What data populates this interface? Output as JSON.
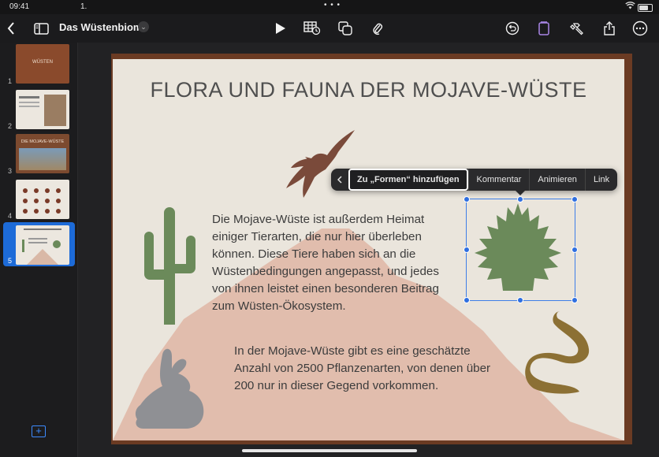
{
  "status": {
    "time": "09:41",
    "carrier": "1."
  },
  "toolbar": {
    "document_title": "Das Wüstenbiom",
    "colors": {
      "accent_icon": "#a986e6"
    }
  },
  "navigator": {
    "slides": [
      {
        "number": "1",
        "title": "WÜSTEN"
      },
      {
        "number": "2",
        "title": ""
      },
      {
        "number": "3",
        "title": "DIE MOJAVE-WÜSTE"
      },
      {
        "number": "4",
        "title": ""
      },
      {
        "number": "5",
        "title": "",
        "selected": true
      }
    ]
  },
  "slide": {
    "title": "FLORA UND FAUNA DER MOJAVE-WÜSTE",
    "paragraph_1": "Die Mojave-Wüste ist außerdem Heimat einiger Tierarten, die nur hier überleben können. Diese Tiere haben sich an die Wüstenbedingungen angepasst, und jedes von ihnen leistet einen besonderen Beitrag zum Wüsten-Ökosystem.",
    "paragraph_2": "In der Mojave-Wüste gibt es eine geschätzte Anzahl von 2500 Pflanzenarten, von denen über 200 nur in dieser Gegend vorkommen."
  },
  "context_menu": {
    "items": [
      "Zu „Formen“ hinzufügen",
      "Kommentar",
      "Animieren",
      "Link"
    ]
  }
}
